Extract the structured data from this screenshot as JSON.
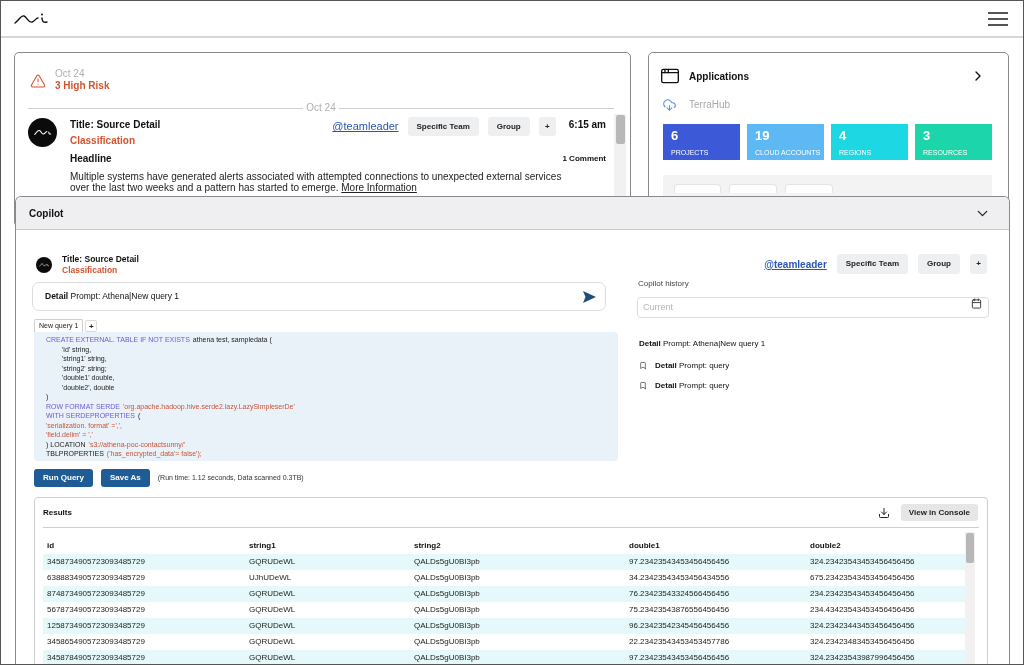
{
  "alerts": {
    "date": "Oct 24",
    "risk": "3 High Risk",
    "divider_date": "Oct 24",
    "item": {
      "title": "Title: Source Detail",
      "classification": "Classification",
      "mention": "@teamleader",
      "tags": [
        "Specific Team",
        "Group"
      ],
      "add": "+",
      "time": "6:15 am",
      "headline": "Headline",
      "comments": "1 Comment",
      "body": "Multiple systems have generated alerts associated with attempted connections to unexpected external services over the last two weeks and a pattern has started to emerge.",
      "link": "More Information"
    }
  },
  "applications": {
    "title": "Applications",
    "source": "TerraHub",
    "stats": [
      {
        "value": "6",
        "label": "PROJECTS",
        "color": "#3c5ad7"
      },
      {
        "value": "19",
        "label": "CLOUD ACCOUNTS",
        "color": "#5db8f3"
      },
      {
        "value": "4",
        "label": "REGIONS",
        "color": "#1dd8e2"
      },
      {
        "value": "3",
        "label": "RESOURCES",
        "color": "#1dd5aa"
      }
    ]
  },
  "copilot": {
    "title": "Copilot",
    "expanded": true,
    "item": {
      "title": "Title: Source Detail",
      "classification": "Classification",
      "mention": "@teamleader",
      "tags": [
        "Specific Team",
        "Group"
      ],
      "add": "+"
    },
    "prompt": {
      "value": "**Detail** Prompt: Athena|New query 1"
    },
    "editor": {
      "tabs": [
        {
          "label": "New query 1",
          "selected": true
        }
      ],
      "add_tab": "+",
      "code_lines": [
        {
          "indented": false,
          "tokens": [
            {
              "kind": "keyword",
              "text": "CREATE EXTERNAL. TABLE IF NOT EXISTS"
            },
            {
              "kind": "plain",
              "text": "athena test, sampledata ("
            }
          ]
        },
        {
          "indented": true,
          "tokens": [
            {
              "kind": "plain",
              "text": "'id' string,"
            }
          ]
        },
        {
          "indented": true,
          "tokens": [
            {
              "kind": "plain",
              "text": "'string1' string,"
            }
          ]
        },
        {
          "indented": true,
          "tokens": [
            {
              "kind": "plain",
              "text": "'string2' string;"
            }
          ]
        },
        {
          "indented": true,
          "tokens": [
            {
              "kind": "plain",
              "text": "'double1' double,"
            }
          ]
        },
        {
          "indented": true,
          "tokens": [
            {
              "kind": "plain",
              "text": "'double2', double"
            }
          ]
        },
        {
          "indented": false,
          "tokens": [
            {
              "kind": "plain",
              "text": ")"
            }
          ]
        },
        {
          "indented": false,
          "tokens": [
            {
              "kind": "keyword",
              "text": "ROW FORMAT SERDE"
            },
            {
              "kind": "string",
              "text": "'org.apache.hadoop.hive.serde2.lazy.LazySimpleserDe'"
            }
          ]
        },
        {
          "indented": false,
          "tokens": [
            {
              "kind": "keyword",
              "text": "WITH SERDEPROPERTIES"
            },
            {
              "kind": "plain",
              "text": "("
            }
          ]
        },
        {
          "indented": false,
          "tokens": [
            {
              "kind": "string",
              "text": "'serialization. format' =',',"
            }
          ]
        },
        {
          "indented": false,
          "tokens": [
            {
              "kind": "string",
              "text": "'field.delim' = ','"
            }
          ]
        },
        {
          "indented": false,
          "tokens": [
            {
              "kind": "plain",
              "text": ") LOCATION"
            },
            {
              "kind": "string",
              "text": "'s3://athena-poc-contactsunny/'"
            }
          ]
        },
        {
          "indented": false,
          "tokens": [
            {
              "kind": "plain",
              "text": "TBLPROPERTIES"
            },
            {
              "kind": "string",
              "text": "('has_encrypted_data'= false');"
            }
          ]
        }
      ]
    },
    "actions": [
      "Run Query",
      "Save As"
    ],
    "run_info": "(Run time: 1.12 seconds, Data scanned 0.3TB)",
    "history": {
      "label": "Copilot history",
      "placeholder": "Current",
      "current": "**Detail** Prompt: Athena|New query 1",
      "items": [
        "**Detail** Prompt: query",
        "**Detail** Prompt: query"
      ]
    },
    "results": {
      "title": "Results",
      "action": "View in Console",
      "table": {
        "columns": [
          "id",
          "string1",
          "string2",
          "double1",
          "double2"
        ],
        "rows": [
          [
            "3458734905723093485729",
            "GQRUDeWL",
            "QALDs5gU0BI3pb",
            "97.23423543453456456456",
            "324.23423543453456456456"
          ],
          [
            "6388834905723093485729",
            "UJhUDeWL",
            "QALDs5gU0BI3pb",
            "34.23423543453456434556",
            "675.23423543453456456456"
          ],
          [
            "8748734905723093485729",
            "GQRUDeWL",
            "QALDs5gU0BI3pb",
            "76.23423543324566456456",
            "234.23423543453456456456"
          ],
          [
            "5678734905723093485729",
            "GQRUDeWL",
            "QALDs5gU0BI3pb",
            "75.23423543876556456456",
            "234.43423543453456456456"
          ],
          [
            "1258734905723093485729",
            "GQRUDeWL",
            "QALDs5gU0BI3pb",
            "96.23423542345456456456",
            "324.23423443453456456456"
          ],
          [
            "3458654905723093485729",
            "GQRUDeWL",
            "QALDs5gU0BI3pb",
            "22.23423543453453457786",
            "324.23423483453456456456"
          ],
          [
            "3458784905723093485729",
            "GQRUDeWL",
            "QALDs5gU0BI3pb",
            "97.23423543453456456456",
            "324.23423543987996456456"
          ]
        ]
      }
    }
  }
}
